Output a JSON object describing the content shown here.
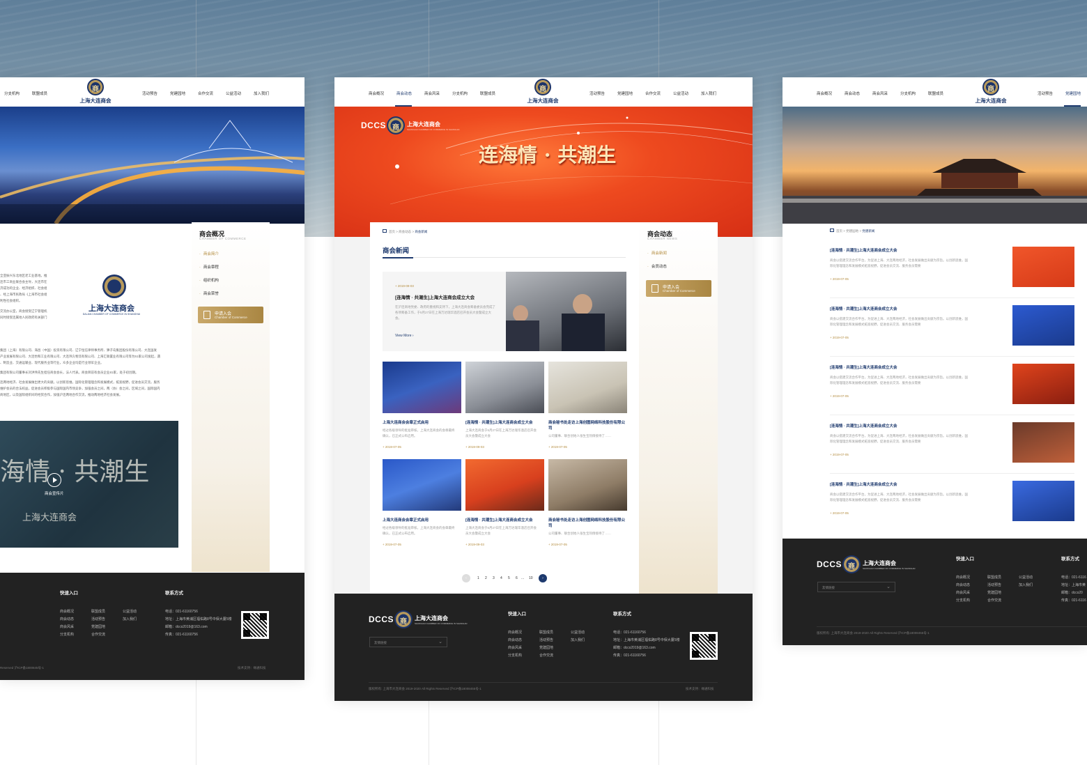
{
  "nav": {
    "items": [
      "商会概况",
      "商会动态",
      "商会风采",
      "分支机构",
      "联盟成员",
      "活动预告",
      "党建园地",
      "合作交流",
      "公益活动",
      "加入我们"
    ],
    "left_partial": [
      "分支机构",
      "联盟成员",
      "活动预告",
      "党建园地",
      "合作交流",
      "公益活动",
      "加入我们"
    ],
    "logo_text": "上海大连商会"
  },
  "left_page": {
    "sidebar": {
      "title": "商会概况",
      "subtitle": "CHAMBER OF COMMERCE",
      "items": [
        "商会简介",
        "商会章程",
        "组织机构",
        "商会荣誉"
      ]
    },
    "body_lines": [
      "全亚振兴东北地区老工业基地。推",
      "连市工商业联合会主导，大连市在",
      "济成功的企业、经济组织、社会组",
      "、经上海市民政局《上海市社会组",
      "利性社会组织。",
      "交流办公室，商会接受辽宁管理机",
      "同时接受连属地人民政府有关部门",
      "集团（上海）有限公司、海昌（中国）投资有限公司、辽宁恒信律师事务所、獐子岛集团股份有限公司、大连国发",
      "产业发展有限公司、大连怡和工业有限公司、大连玮久物流有限公司、上海汇联置业有限公司等为51家公司发起，遇",
      "、制造业、交通运输业、现代服务业等行业，众多企业均是行业领军企业。",
      "集团有限公司董事长刘洪伟先生担任商会会长，法人代表。商会目前有会员企业81家，处于初创期。",
      "连两地经济、社会发展做出更大的贡献。以创新思维，国际化管理理念和发展模式，拓宽视野，促进会员交流，服务",
      "维护会员的合法权益，促进会员积极参与国际国内市场竞争，加强会员之间，两（协）会之间，区域之间，国际国内",
      "商地区，以及国际组织间的经贸合作，加强沪连两地合作交流，推动两地经济社会发展。"
    ],
    "logo_caption": "上海大连商会",
    "logo_sub": "DALIAN CHAMBER OF COMMERCE IN SHANGHAI",
    "video_title": "商会宣传片",
    "video_art": "海情 · 共潮生",
    "video_art2": "上海大连商会",
    "apply": {
      "line1": "申请入会",
      "line2": "Chamber of Commerce"
    }
  },
  "center_page": {
    "banner_slogan": "连海情 · 共潮生",
    "banner_logo": {
      "dccs": "DCCS",
      "name": "上海大连商会",
      "sub": "SHANGHAI CHAMBER OF COMMERCE IN SHANGHAI"
    },
    "breadcrumb": {
      "home": "首页",
      "mid": "商会动态",
      "current": "商会新闻",
      "sep": ">"
    },
    "section_title": "商会新闻",
    "featured": {
      "date": "+ 2019-09-03",
      "title": "[连海情 · 共潮生]上海大连商会成立大会",
      "desc": "在沪连商地党委、政府的重视和支持下，上海大连商会筹备委员会完成了各项筹备工作，于5月27日在上海万达瑞华酒店召开会员大会暨成立大会。",
      "more": "View More"
    },
    "cards": [
      {
        "title": "上海大连商会会章正式启用",
        "desc": "经过各级领导的批准审核，上海大连商会的会章最终确认，已正式公布启用。",
        "date": "+ 2019-07-05"
      },
      {
        "title": "[连海情 · 共潮生]上海大连商会成立大会",
        "desc": "上海大连商会于5月27日在上海万达瑞华酒店召开会员大会暨成立大会",
        "date": "+ 2019-09-03"
      },
      {
        "title": "商会秘书处走访上海创图网络科技股份有限公司",
        "desc": "公司董事、联合创始人张生宝热情接待了……",
        "date": "+ 2019-07-05"
      },
      {
        "title": "上海大连商会会章正式启用",
        "desc": "经过各级领导的批准审核，上海大连商会的会章最终确认，已正式公布启用。",
        "date": "+ 2019-07-05"
      },
      {
        "title": "[连海情 · 共潮生]上海大连商会成立大会",
        "desc": "上海大连商会于5月27日在上海万达瑞华酒店召开会员大会暨成立大会",
        "date": "+ 2019-09-03"
      },
      {
        "title": "商会秘书处走访上海创图网络科技股份有限公司",
        "desc": "公司董事、联合创始人张生宝热情接待了……",
        "date": "+ 2019-07-05"
      }
    ],
    "pager": [
      "1",
      "2",
      "3",
      "4",
      "5",
      "6",
      "...",
      "10"
    ],
    "sidebar": {
      "title": "商会动态",
      "subtitle": "CHAMBER NEWS",
      "items": [
        "商会新闻",
        "会员动态"
      ]
    },
    "apply": {
      "line1": "申请入会",
      "line2": "Chamber of Commerce"
    }
  },
  "right_page": {
    "breadcrumb": {
      "home": "首页",
      "mid": "党建园地",
      "current": "党建新闻",
      "sep": ">"
    },
    "items": [
      {
        "title": "[连海情 · 共潮生]上海大连商会成立大会",
        "desc": "商会以搭建交流合作平台，为促进上海、大连两地经济，社会发展做出贡献为宗旨。以创新思维，国际化管理理念和发展模式拓宽视野，促进会员交流、服务会员需要",
        "date": "+ 2019-07-05"
      },
      {
        "title": "[连海情 · 共潮生]上海大连商会成立大会",
        "desc": "商会以搭建交流合作平台，为促进上海、大连两地经济，社会发展做出贡献为宗旨。以创新思维，国际化管理理念和发展模式拓宽视野，促进会员交流、服务会员需要",
        "date": "+ 2019-07-05"
      },
      {
        "title": "[连海情 · 共潮生]上海大连商会成立大会",
        "desc": "商会以搭建交流合作平台，为促进上海、大连两地经济，社会发展做出贡献为宗旨。以创新思维，国际化管理理念和发展模式拓宽视野，促进会员交流、服务会员需要",
        "date": "+ 2019-07-05"
      },
      {
        "title": "[连海情 · 共潮生]上海大连商会成立大会",
        "desc": "商会以搭建交流合作平台，为促进上海、大连两地经济，社会发展做出贡献为宗旨。以创新思维，国际化管理理念和发展模式拓宽视野，促进会员交流、服务会员需要",
        "date": "+ 2019-07-05"
      },
      {
        "title": "[连海情 · 共潮生]上海大连商会成立大会",
        "desc": "商会以搭建交流合作平台，为促进上海、大连两地经济，社会发展做出贡献为宗旨。以创新思维，国际化管理理念和发展模式拓宽视野，促进会员交流、服务会员需要",
        "date": "+ 2019-07-05"
      }
    ]
  },
  "footer": {
    "quick_title": "快速入口",
    "contact_title": "联系方式",
    "links": [
      "商会概况",
      "联盟成员",
      "公益活动",
      "商会动态",
      "活动预告",
      "加入我们",
      "商会风采",
      "党建园地",
      "分支机构",
      "合作交流"
    ],
    "phone": "电话：021-61160756",
    "address": "地址：上海市黄浦区福佑路8号中保大厦5楼",
    "email": "邮箱：dccs2019@163.com",
    "fax": "传真：021-61160756",
    "friend_link": "友情链接",
    "copyright": "版权所有: 上海市大连商会 2019-2020 All Rights Reserved 沪ICP备18008455号-1",
    "copyright_short": "Reserved 沪ICP备1800845号-1",
    "tech": "技术支持：缘通科技",
    "dccs": "DCCS",
    "name": "上海大连商会",
    "name_sub": "SHANGHAI CHAMBER OF COMMERCE IN SHANGHAI",
    "right_phone": "电话：021-6116",
    "right_addr": "地址：上海市黄",
    "right_email": "邮箱：dccs20",
    "right_fax": "传真：021-6116"
  },
  "colors": {
    "navy": "#1e3a6e",
    "gold": "#b38b3e",
    "banner_red": "#e8401c",
    "footer": "#222222"
  }
}
